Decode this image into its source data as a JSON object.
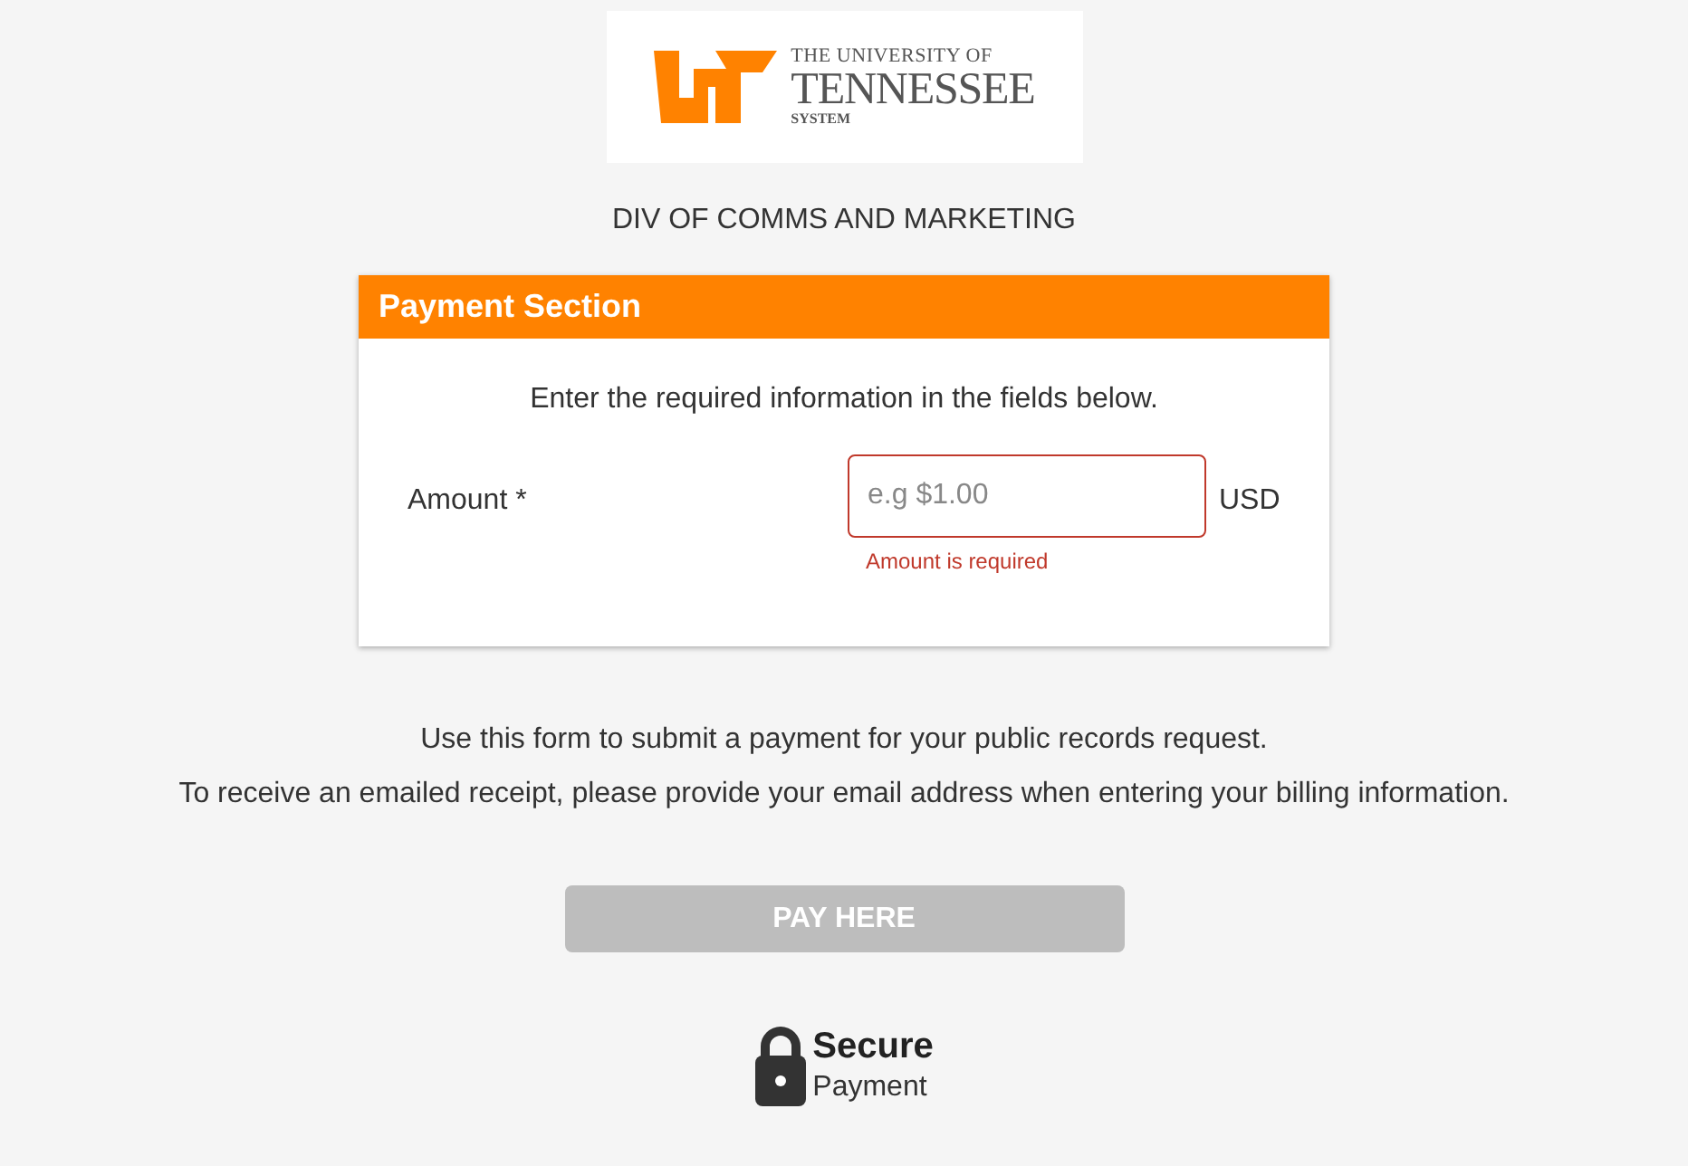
{
  "logo": {
    "line_1": "THE UNIVERSITY OF",
    "line_2": "TENNESSEE",
    "line_3": "SYSTEM"
  },
  "department": "DIV OF COMMS AND MARKETING",
  "payment_section": {
    "title": "Payment Section",
    "instructions": "Enter the required information in the fields below.",
    "amount_field": {
      "label": "Amount *",
      "placeholder": "e.g $1.00",
      "currency": "USD",
      "invalid": true,
      "error": "Amount is required"
    }
  },
  "notes": [
    "Use this form to submit a payment for your public records request.",
    "To receive an emailed receipt, please provide your email address when entering your billing information."
  ],
  "pay_button": {
    "label": "PAY HERE",
    "disabled": true
  },
  "secure_badge": {
    "title": "Secure",
    "subtitle": "Payment"
  }
}
